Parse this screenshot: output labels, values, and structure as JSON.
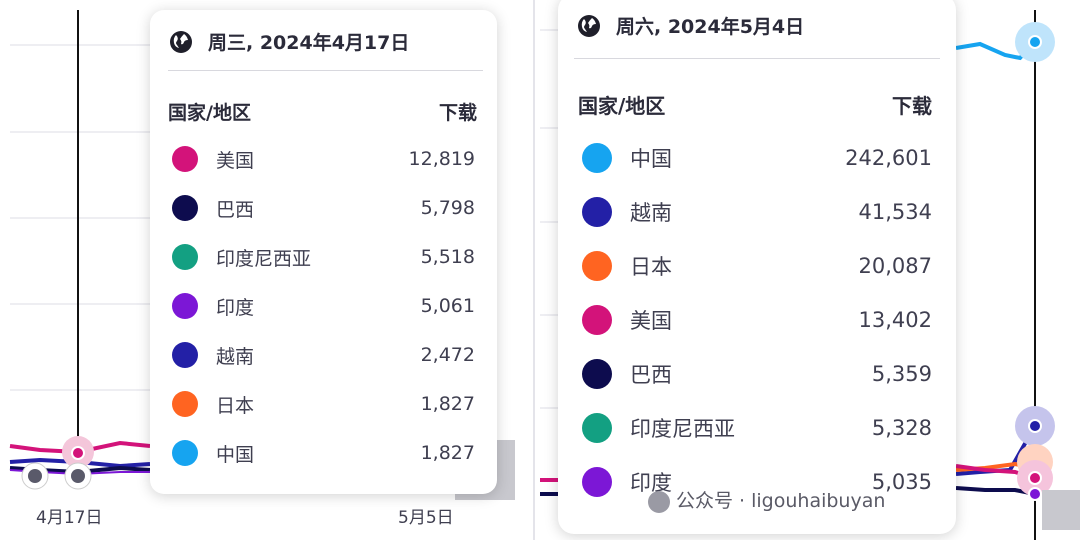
{
  "chart_data": [
    {
      "type": "line",
      "tooltip": {
        "date": "周三, 2024年4月17日",
        "country_header": "国家/地区",
        "value_header": "下载",
        "rows": [
          {
            "country": "美国",
            "value": "12,819",
            "color": "#d3137a"
          },
          {
            "country": "巴西",
            "value": "5,798",
            "color": "#0d0c4e"
          },
          {
            "country": "印度尼西亚",
            "value": "5,518",
            "color": "#13a082"
          },
          {
            "country": "印度",
            "value": "5,061",
            "color": "#7c17d6"
          },
          {
            "country": "越南",
            "value": "2,472",
            "color": "#2320a6"
          },
          {
            "country": "日本",
            "value": "1,827",
            "color": "#ff6421"
          },
          {
            "country": "中国",
            "value": "1,827",
            "color": "#16a4f0"
          }
        ]
      },
      "x_tick_labels": [
        "4月17日",
        "5月5日"
      ]
    },
    {
      "type": "line",
      "tooltip": {
        "date": "周六, 2024年5月4日",
        "country_header": "国家/地区",
        "value_header": "下载",
        "rows": [
          {
            "country": "中国",
            "value": "242,601",
            "color": "#16a4f0"
          },
          {
            "country": "越南",
            "value": "41,534",
            "color": "#2320a6"
          },
          {
            "country": "日本",
            "value": "20,087",
            "color": "#ff6421"
          },
          {
            "country": "美国",
            "value": "13,402",
            "color": "#d3137a"
          },
          {
            "country": "巴西",
            "value": "5,359",
            "color": "#0d0c4e"
          },
          {
            "country": "印度尼西亚",
            "value": "5,328",
            "color": "#13a082"
          },
          {
            "country": "印度",
            "value": "5,035",
            "color": "#7c17d6"
          }
        ]
      }
    }
  ],
  "watermark": "公众号 · ligouhaibuyan"
}
